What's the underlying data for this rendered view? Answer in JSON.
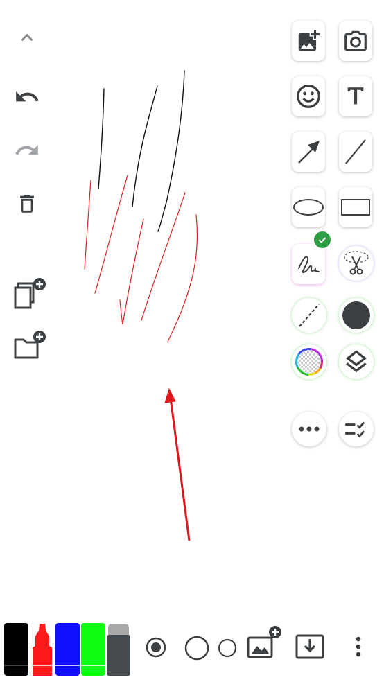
{
  "colors": {
    "icon": "#3c4043",
    "icon_disabled": "#a0a4a8",
    "stroke_black": "#111111",
    "stroke_red": "#e02020",
    "marker_black": "#000000",
    "marker_red": "#ff1a1a",
    "marker_blue": "#1010ff",
    "marker_green": "#10ff10",
    "marker_gray": "#454a4e",
    "check_green": "#2e9e44"
  },
  "left_toolbar": [
    "collapse-up-icon",
    "undo-icon",
    "redo-icon",
    "delete-icon",
    "add-page-icon",
    "add-folder-icon"
  ],
  "tool_grid": [
    "add-image-icon",
    "camera-icon",
    "emoji-icon",
    "text-tool-icon",
    "arrow-tool-icon",
    "line-tool-icon",
    "ellipse-tool-icon",
    "rectangle-tool-icon",
    "freehand-pen-icon",
    "lasso-cut-icon",
    "dashed-line-icon",
    "fill-circle-icon",
    "color-picker-icon",
    "layers-icon",
    "more-icon",
    "checklist-icon"
  ],
  "selected_tool": "freehand-pen-icon",
  "bottom_toolbar": {
    "markers": [
      "black",
      "red",
      "blue",
      "green",
      "eraser"
    ],
    "selected_marker": "red",
    "brush_sizes": [
      "radio-selected-icon",
      "large-circle-icon",
      "small-circle-icon"
    ],
    "actions": [
      "add-background-image-icon",
      "save-download-icon",
      "overflow-menu-icon"
    ]
  }
}
